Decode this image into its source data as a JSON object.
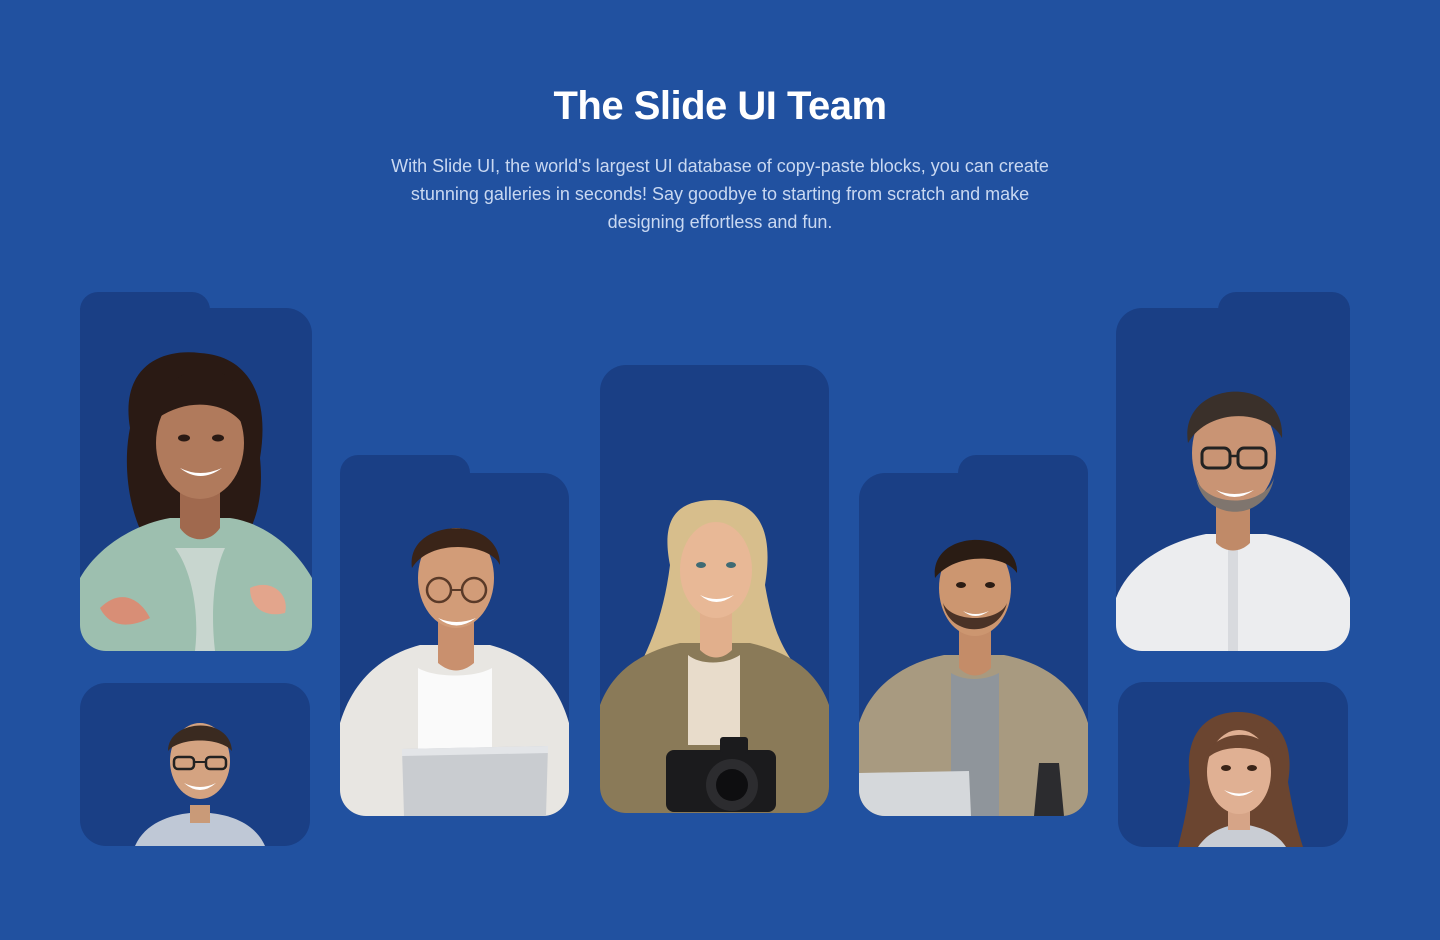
{
  "section": {
    "title": "The Slide UI Team",
    "description": "With Slide UI, the world's largest UI database of copy-paste blocks, you can create stunning galleries in seconds! Say goodbye to starting from scratch and make designing effortless and fun."
  },
  "colors": {
    "background": "#2151A0",
    "card": "#1A3F85",
    "title": "#FFFFFF",
    "description": "#C9D8F1"
  },
  "team": [
    {
      "id": "member-1",
      "portrait": "smiling woman with curly dark hair in floral blouse"
    },
    {
      "id": "member-2",
      "portrait": "smiling man with glasses"
    },
    {
      "id": "member-3",
      "portrait": "smiling man with glasses holding laptop"
    },
    {
      "id": "member-4",
      "portrait": "smiling blonde woman holding camera"
    },
    {
      "id": "member-5",
      "portrait": "smiling man with beard in jacket holding laptop"
    },
    {
      "id": "member-6",
      "portrait": "smiling man with glasses in white shirt"
    },
    {
      "id": "member-7",
      "portrait": "smiling woman with brown hair"
    }
  ]
}
